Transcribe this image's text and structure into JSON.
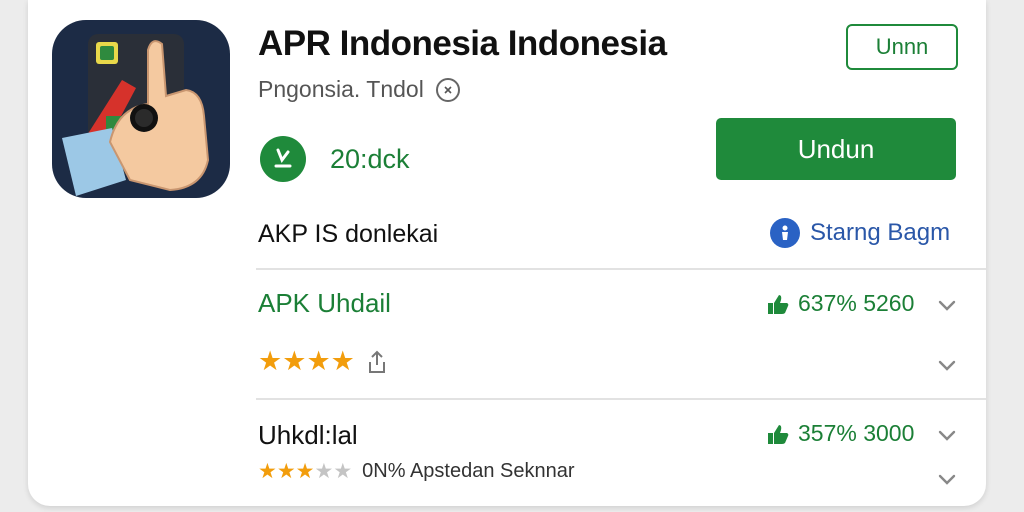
{
  "app": {
    "title": "APR Indonesia Indonesia",
    "developer": "Pngonsia. Tndol",
    "info_icon": "ⓘ",
    "downloads": "20:dck",
    "icon_name": "hand-touch-app-icon"
  },
  "buttons": {
    "outline_label": "Unnn",
    "primary_label": "Undun"
  },
  "section": {
    "title": "AKP IS donlekai",
    "share_label": "Starng Bagm"
  },
  "rows": [
    {
      "title": "APK Uhdail",
      "stat": "637% 5260",
      "rating": 4,
      "stars_total": 4
    },
    {
      "title": "Uhkdl:lal",
      "stat": "357% 3000",
      "rating": 3,
      "stars_total": 5,
      "subtext": "0N% Apstedan Seknnar"
    }
  ],
  "colors": {
    "accent_green": "#1f8a3b",
    "link_blue": "#2a57a8",
    "star_orange": "#f29d0c",
    "icon_bg": "#1c2b45"
  }
}
